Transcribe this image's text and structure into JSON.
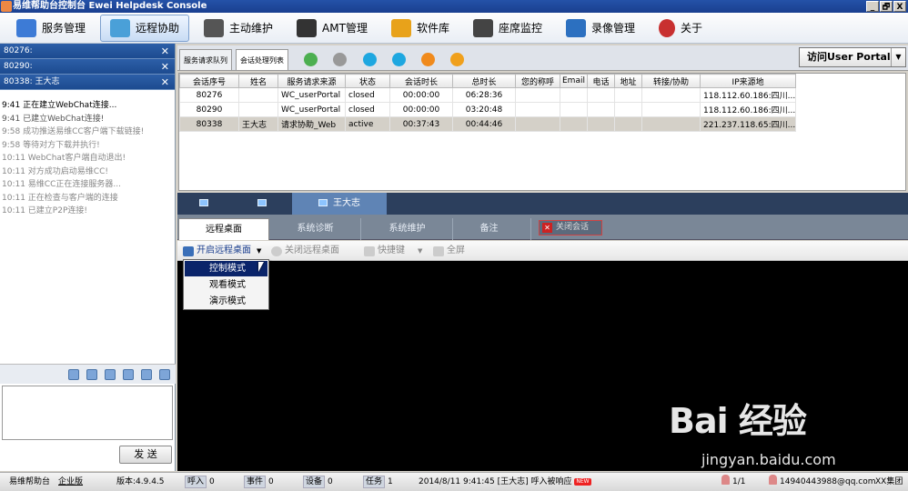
{
  "title": "易维帮助台控制台 Ewei Helpdesk Console",
  "window_controls": [
    "_",
    "🗗",
    "X"
  ],
  "menu": [
    {
      "label": "服务管理",
      "color": "#3d7bd6"
    },
    {
      "label": "远程协助",
      "color": "#4aa0d8"
    },
    {
      "label": "主动维护",
      "color": "#555555"
    },
    {
      "label": "AMT管理",
      "color": "#333333"
    },
    {
      "label": "软件库",
      "color": "#e8a21a"
    },
    {
      "label": "座席监控",
      "color": "#444444"
    },
    {
      "label": "录像管理",
      "color": "#2c70c0"
    },
    {
      "label": "关于",
      "color": "#c83030"
    }
  ],
  "sessions": [
    {
      "label": "80276:"
    },
    {
      "label": "80290:"
    },
    {
      "label": "80338: 王大志"
    }
  ],
  "log": [
    "9:41 正在建立WebChat连接...",
    "9:41 已建立WebChat连接!",
    "9:58 成功推送易维CC客户端下载链接!",
    "9:58 等待对方下载并执行!",
    "10:11 WebChat客户端自动退出!",
    "10:11 对方成功启动易维CC!",
    "10:11 易维CC正在连接服务器...",
    "10:11 正在检查与客户端的连接",
    "10:11 已建立P2P连接!"
  ],
  "send_label": "发 送",
  "subtabs": [
    "服务请求队列",
    "会话处理列表"
  ],
  "portal_label": "访问User Portal",
  "columns": [
    "会话序号",
    "姓名",
    "服务请求来源",
    "状态",
    "会话时长",
    "总时长",
    "您的称呼",
    "Email",
    "电话",
    "地址",
    "转接/协助",
    "IP来源地"
  ],
  "rows": [
    [
      "80276",
      "",
      "WC_userPortal",
      "closed",
      "00:00:00",
      "06:28:36",
      "",
      "",
      "",
      "",
      "",
      "118.112.60.186:四川..."
    ],
    [
      "80290",
      "",
      "WC_userPortal",
      "closed",
      "00:00:00",
      "03:20:48",
      "",
      "",
      "",
      "",
      "",
      "118.112.60.186:四川..."
    ],
    [
      "80338",
      "王大志",
      "请求协助_Web",
      "active",
      "00:37:43",
      "00:44:46",
      "",
      "",
      "",
      "",
      "",
      "221.237.118.65:四川..."
    ]
  ],
  "chat_tabs": [
    "",
    "",
    "王大志"
  ],
  "tool_tabs": [
    "远程桌面",
    "系统诊断",
    "系统维护",
    "备注"
  ],
  "close_session": "关闭会话",
  "rd_toolbar": {
    "start": "开启远程桌面",
    "stop": "关闭远程桌面",
    "shortcut": "快捷键",
    "fullscreen": "全屏"
  },
  "dropdown": [
    "控制模式",
    "观看模式",
    "演示模式"
  ],
  "watermark": {
    "brand": "Bai  经验",
    "url": "jingyan.baidu.com"
  },
  "status": {
    "app": "易维帮助台",
    "edition": "企业版",
    "version": "版本:4.9.4.5",
    "incoming_label": "呼入",
    "incoming": "0",
    "events_label": "事件",
    "events": "0",
    "devices_label": "设备",
    "devices": "0",
    "tasks_label": "任务",
    "tasks": "1",
    "message": "2014/8/11 9:41:45 [王大志] 呼入被响应",
    "new": "NEW",
    "agents": "1/1",
    "user": "14940443988@qq.com",
    "group": "XX集团"
  }
}
